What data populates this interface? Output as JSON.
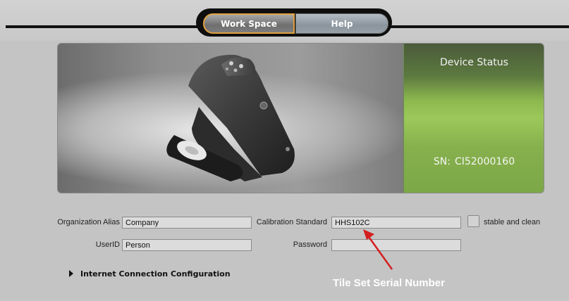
{
  "tabs": {
    "work_space": "Work Space",
    "help": "Help"
  },
  "device_status": {
    "title": "Device Status",
    "serial_prefix": "SN:",
    "serial_number": "CI52000160"
  },
  "form": {
    "organization_alias": {
      "label": "Organization Alias",
      "value": "Company"
    },
    "user_id": {
      "label": "UserID",
      "value": "Person"
    },
    "calibration_standard": {
      "label": "Calibration Standard",
      "value": "HHS102C"
    },
    "password": {
      "label": "Password",
      "value": ""
    },
    "stable_clean": {
      "label": "stable and clean",
      "checked": false
    }
  },
  "internet_config": {
    "label": "Internet Connection Configuration"
  },
  "annotation": {
    "text": "Tile Set Serial Number",
    "arrow_color": "#d41f1f"
  },
  "colors": {
    "tab_active_border": "#e0a040",
    "status_green": "#8cb84e"
  }
}
